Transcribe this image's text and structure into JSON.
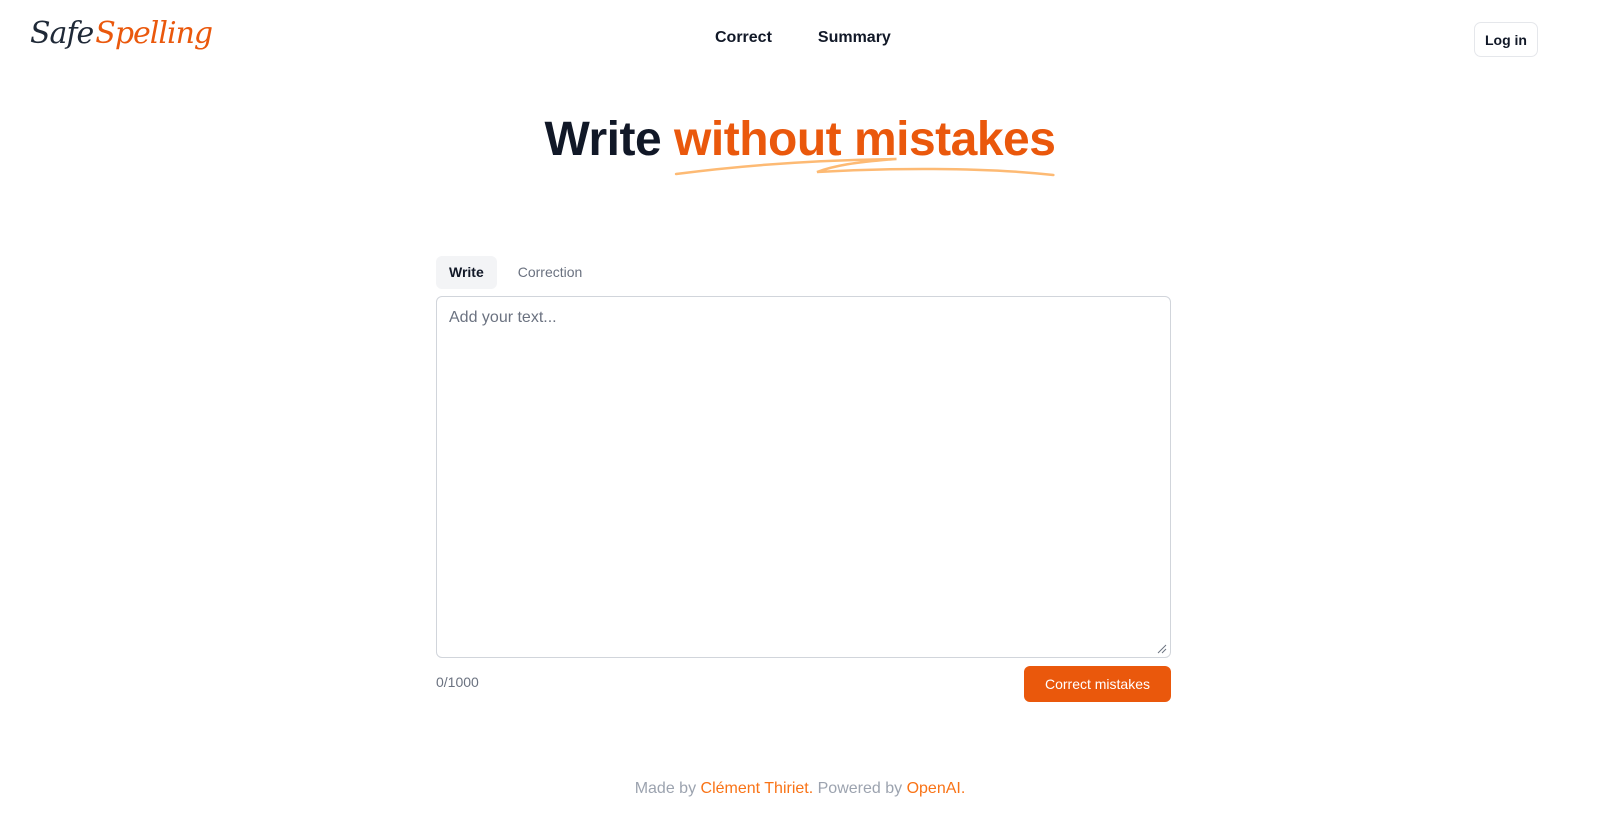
{
  "header": {
    "logo": {
      "part1": "Safe",
      "part2": "Spelling"
    },
    "nav": [
      {
        "label": "Correct"
      },
      {
        "label": "Summary"
      }
    ],
    "login_label": "Log in"
  },
  "hero": {
    "title_plain": "Write",
    "title_accent": "without mistakes"
  },
  "editor": {
    "tabs": [
      {
        "label": "Write",
        "active": true
      },
      {
        "label": "Correction",
        "active": false
      }
    ],
    "placeholder": "Add your text...",
    "value": "",
    "counter": "0/1000",
    "submit_label": "Correct mistakes"
  },
  "footer": {
    "made_by_prefix": "Made by",
    "author": "Clément Thiriet.",
    "powered_by_prefix": "Powered by",
    "powered_by": "OpenAI."
  },
  "colors": {
    "accent": "#ea580c",
    "accent_light": "#f97316",
    "text": "#111827",
    "muted": "#6b7280"
  }
}
